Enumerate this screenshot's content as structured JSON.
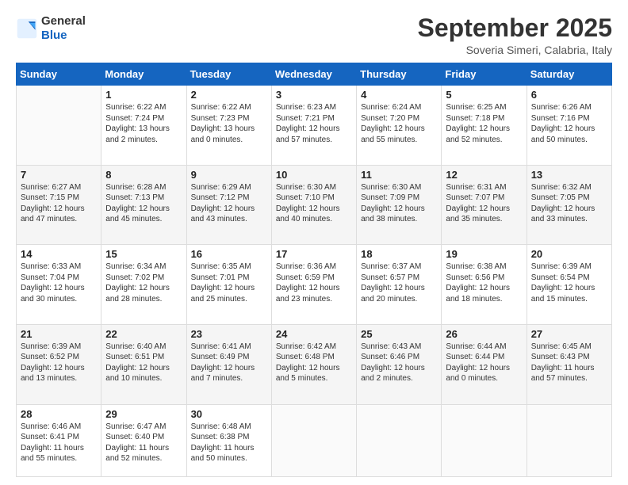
{
  "header": {
    "logo": {
      "general": "General",
      "blue": "Blue"
    },
    "title": "September 2025",
    "location": "Soveria Simeri, Calabria, Italy"
  },
  "days_of_week": [
    "Sunday",
    "Monday",
    "Tuesday",
    "Wednesday",
    "Thursday",
    "Friday",
    "Saturday"
  ],
  "weeks": [
    [
      {
        "day": "",
        "sunrise": "",
        "sunset": "",
        "daylight": ""
      },
      {
        "day": "1",
        "sunrise": "6:22 AM",
        "sunset": "7:24 PM",
        "daylight": "13 hours and 2 minutes."
      },
      {
        "day": "2",
        "sunrise": "6:22 AM",
        "sunset": "7:23 PM",
        "daylight": "13 hours and 0 minutes."
      },
      {
        "day": "3",
        "sunrise": "6:23 AM",
        "sunset": "7:21 PM",
        "daylight": "12 hours and 57 minutes."
      },
      {
        "day": "4",
        "sunrise": "6:24 AM",
        "sunset": "7:20 PM",
        "daylight": "12 hours and 55 minutes."
      },
      {
        "day": "5",
        "sunrise": "6:25 AM",
        "sunset": "7:18 PM",
        "daylight": "12 hours and 52 minutes."
      },
      {
        "day": "6",
        "sunrise": "6:26 AM",
        "sunset": "7:16 PM",
        "daylight": "12 hours and 50 minutes."
      }
    ],
    [
      {
        "day": "7",
        "sunrise": "6:27 AM",
        "sunset": "7:15 PM",
        "daylight": "12 hours and 47 minutes."
      },
      {
        "day": "8",
        "sunrise": "6:28 AM",
        "sunset": "7:13 PM",
        "daylight": "12 hours and 45 minutes."
      },
      {
        "day": "9",
        "sunrise": "6:29 AM",
        "sunset": "7:12 PM",
        "daylight": "12 hours and 43 minutes."
      },
      {
        "day": "10",
        "sunrise": "6:30 AM",
        "sunset": "7:10 PM",
        "daylight": "12 hours and 40 minutes."
      },
      {
        "day": "11",
        "sunrise": "6:30 AM",
        "sunset": "7:09 PM",
        "daylight": "12 hours and 38 minutes."
      },
      {
        "day": "12",
        "sunrise": "6:31 AM",
        "sunset": "7:07 PM",
        "daylight": "12 hours and 35 minutes."
      },
      {
        "day": "13",
        "sunrise": "6:32 AM",
        "sunset": "7:05 PM",
        "daylight": "12 hours and 33 minutes."
      }
    ],
    [
      {
        "day": "14",
        "sunrise": "6:33 AM",
        "sunset": "7:04 PM",
        "daylight": "12 hours and 30 minutes."
      },
      {
        "day": "15",
        "sunrise": "6:34 AM",
        "sunset": "7:02 PM",
        "daylight": "12 hours and 28 minutes."
      },
      {
        "day": "16",
        "sunrise": "6:35 AM",
        "sunset": "7:01 PM",
        "daylight": "12 hours and 25 minutes."
      },
      {
        "day": "17",
        "sunrise": "6:36 AM",
        "sunset": "6:59 PM",
        "daylight": "12 hours and 23 minutes."
      },
      {
        "day": "18",
        "sunrise": "6:37 AM",
        "sunset": "6:57 PM",
        "daylight": "12 hours and 20 minutes."
      },
      {
        "day": "19",
        "sunrise": "6:38 AM",
        "sunset": "6:56 PM",
        "daylight": "12 hours and 18 minutes."
      },
      {
        "day": "20",
        "sunrise": "6:39 AM",
        "sunset": "6:54 PM",
        "daylight": "12 hours and 15 minutes."
      }
    ],
    [
      {
        "day": "21",
        "sunrise": "6:39 AM",
        "sunset": "6:52 PM",
        "daylight": "12 hours and 13 minutes."
      },
      {
        "day": "22",
        "sunrise": "6:40 AM",
        "sunset": "6:51 PM",
        "daylight": "12 hours and 10 minutes."
      },
      {
        "day": "23",
        "sunrise": "6:41 AM",
        "sunset": "6:49 PM",
        "daylight": "12 hours and 7 minutes."
      },
      {
        "day": "24",
        "sunrise": "6:42 AM",
        "sunset": "6:48 PM",
        "daylight": "12 hours and 5 minutes."
      },
      {
        "day": "25",
        "sunrise": "6:43 AM",
        "sunset": "6:46 PM",
        "daylight": "12 hours and 2 minutes."
      },
      {
        "day": "26",
        "sunrise": "6:44 AM",
        "sunset": "6:44 PM",
        "daylight": "12 hours and 0 minutes."
      },
      {
        "day": "27",
        "sunrise": "6:45 AM",
        "sunset": "6:43 PM",
        "daylight": "11 hours and 57 minutes."
      }
    ],
    [
      {
        "day": "28",
        "sunrise": "6:46 AM",
        "sunset": "6:41 PM",
        "daylight": "11 hours and 55 minutes."
      },
      {
        "day": "29",
        "sunrise": "6:47 AM",
        "sunset": "6:40 PM",
        "daylight": "11 hours and 52 minutes."
      },
      {
        "day": "30",
        "sunrise": "6:48 AM",
        "sunset": "6:38 PM",
        "daylight": "11 hours and 50 minutes."
      },
      {
        "day": "",
        "sunrise": "",
        "sunset": "",
        "daylight": ""
      },
      {
        "day": "",
        "sunrise": "",
        "sunset": "",
        "daylight": ""
      },
      {
        "day": "",
        "sunrise": "",
        "sunset": "",
        "daylight": ""
      },
      {
        "day": "",
        "sunrise": "",
        "sunset": "",
        "daylight": ""
      }
    ]
  ],
  "labels": {
    "sunrise": "Sunrise:",
    "sunset": "Sunset:",
    "daylight": "Daylight:"
  }
}
